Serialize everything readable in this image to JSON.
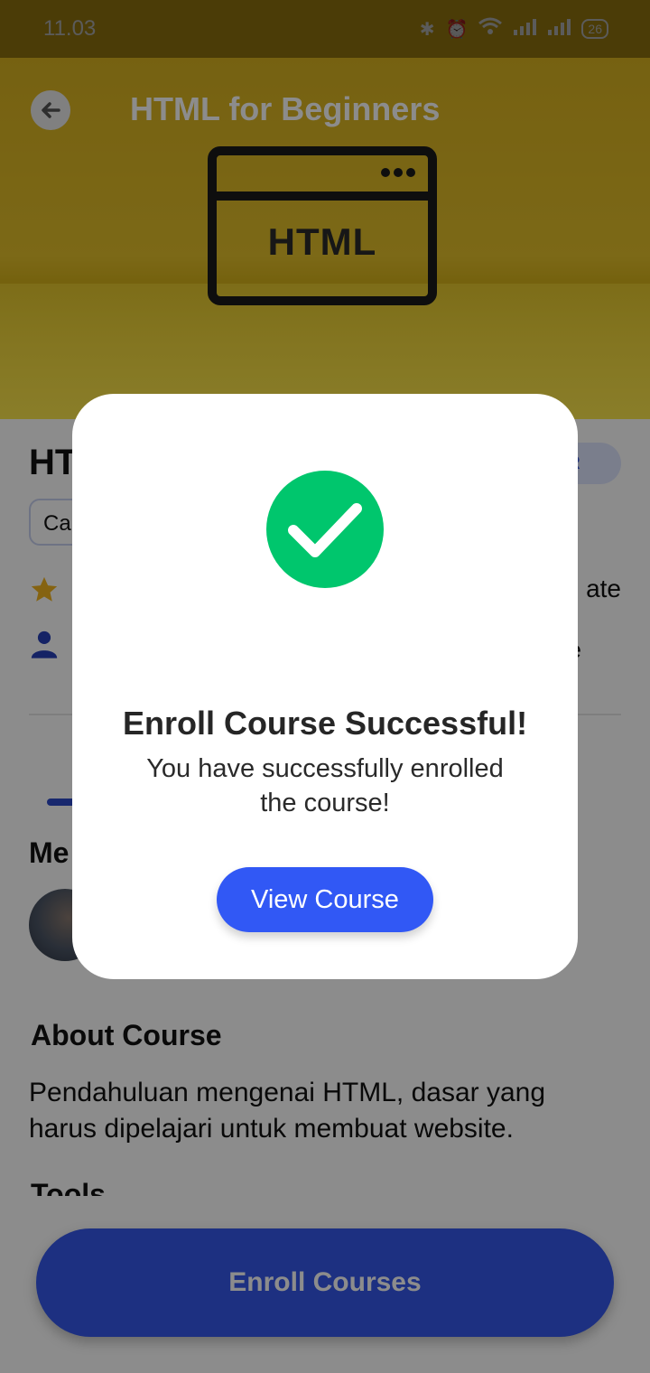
{
  "status_bar": {
    "time": "11.03",
    "battery_level": "26"
  },
  "header": {
    "title": "HTML for Beginners",
    "hero_text": "HTML"
  },
  "course": {
    "title_fragment": "HT",
    "category_fragment": "Ca",
    "level_fragment": "NER",
    "meta_right_1": "ate",
    "meta_right_2": "e"
  },
  "mentor": {
    "heading_fragment": "Me"
  },
  "about": {
    "heading": "About Course",
    "text": "Pendahuluan mengenai HTML, dasar yang harus dipelajari untuk membuat website."
  },
  "tools": {
    "heading": "Tools"
  },
  "enroll_button": {
    "label": "Enroll Courses"
  },
  "dialog": {
    "title": "Enroll Course Successful!",
    "message": "You have successfully enrolled the course!",
    "button_label": "View Course"
  },
  "colors": {
    "hero": "#d7b120",
    "primary": "#3558ec",
    "success": "#00c66d",
    "scrim": "rgba(0,0,0,0.45)"
  }
}
